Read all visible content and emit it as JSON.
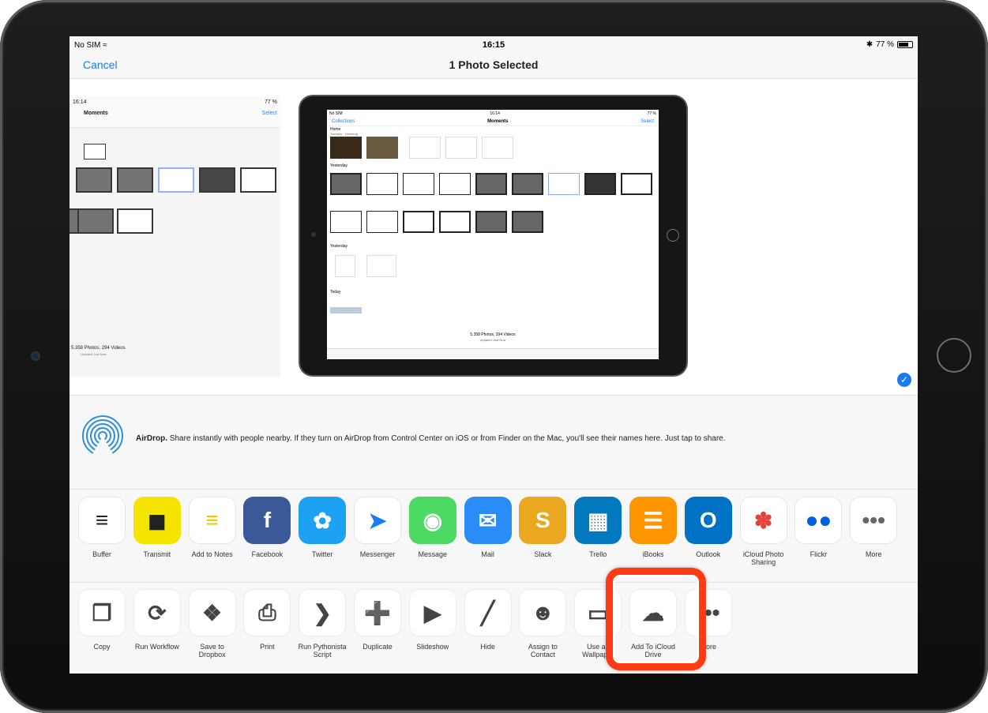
{
  "status": {
    "carrier": "No SIM",
    "time": "16:15",
    "battery": "77 %"
  },
  "nav": {
    "cancel": "Cancel",
    "title": "1 Photo Selected"
  },
  "preview": {
    "thumb1": {
      "time": "16:14",
      "title": "Moments",
      "select": "Select",
      "count": "5.358 Photos, 294 Videos",
      "updated": "Updated Just Now"
    },
    "thumb2": {
      "carrier": "No SIM",
      "time": "16:14",
      "back": "Collections",
      "title": "Moments",
      "select": "Select",
      "home": "Home",
      "home_sub": "Tuesday · Hamburg",
      "yesterday": "Yesterday",
      "today": "Today",
      "count": "5.358 Photos, 294 Videos",
      "updated": "Updated Just Now"
    }
  },
  "airdrop": {
    "title": "AirDrop.",
    "text": " Share instantly with people nearby. If they turn on AirDrop from Control Center on iOS or from Finder on the Mac, you'll see their names here. Just tap to share."
  },
  "apps": [
    {
      "label": "Buffer",
      "icon": "buffer-icon",
      "color": "#ffffff"
    },
    {
      "label": "Transmit",
      "icon": "truck-icon",
      "color": "#f5e400"
    },
    {
      "label": "Add to Notes",
      "icon": "notes-icon",
      "color": "#ffffff"
    },
    {
      "label": "Facebook",
      "icon": "facebook-icon",
      "color": "#3b5998"
    },
    {
      "label": "Twitter",
      "icon": "twitter-icon",
      "color": "#1da1f2"
    },
    {
      "label": "Messenger",
      "icon": "messenger-icon",
      "color": "#ffffff"
    },
    {
      "label": "Message",
      "icon": "message-icon",
      "color": "#4cd964"
    },
    {
      "label": "Mail",
      "icon": "mail-icon",
      "color": "#2a8cf7"
    },
    {
      "label": "Slack",
      "icon": "slack-icon",
      "color": "#e9a820"
    },
    {
      "label": "Trello",
      "icon": "trello-icon",
      "color": "#0079bf"
    },
    {
      "label": "iBooks",
      "icon": "ibooks-icon",
      "color": "#ff9500"
    },
    {
      "label": "Outlook",
      "icon": "outlook-icon",
      "color": "#0072c6"
    },
    {
      "label": "iCloud Photo Sharing",
      "icon": "photos-icon",
      "color": "#ffffff"
    },
    {
      "label": "Flickr",
      "icon": "flickr-icon",
      "color": "#ffffff"
    },
    {
      "label": "More",
      "icon": "more-icon",
      "color": "#ffffff"
    }
  ],
  "actions": [
    {
      "label": "Copy",
      "icon": "copy-icon"
    },
    {
      "label": "Run Workflow",
      "icon": "workflow-icon"
    },
    {
      "label": "Save to Dropbox",
      "icon": "dropbox-icon"
    },
    {
      "label": "Print",
      "icon": "print-icon"
    },
    {
      "label": "Run Pythonista Script",
      "icon": "pythonista-icon"
    },
    {
      "label": "Duplicate",
      "icon": "duplicate-icon"
    },
    {
      "label": "Slideshow",
      "icon": "play-icon"
    },
    {
      "label": "Hide",
      "icon": "hide-icon"
    },
    {
      "label": "Assign to Contact",
      "icon": "contact-icon"
    },
    {
      "label": "Use as Wallpaper",
      "icon": "wallpaper-icon"
    },
    {
      "label": "Add To iCloud Drive",
      "icon": "icloud-upload-icon"
    },
    {
      "label": "More",
      "icon": "more-icon"
    }
  ]
}
